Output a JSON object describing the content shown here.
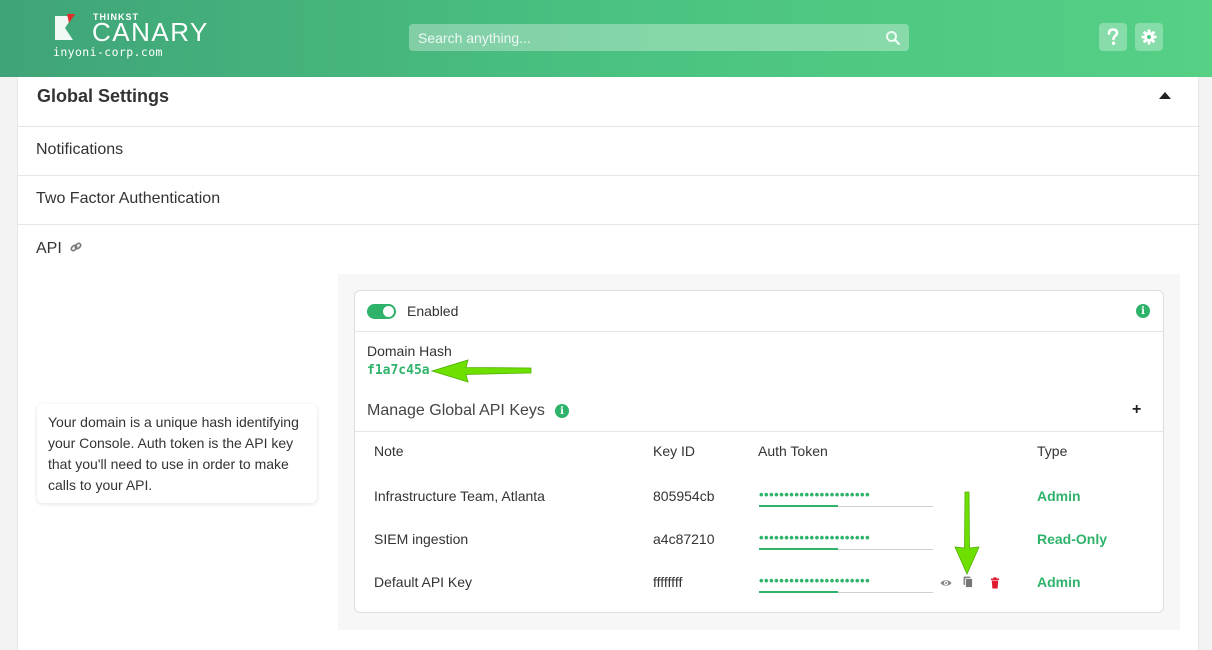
{
  "header": {
    "brand_small": "THINKST",
    "brand_big": "CANARY",
    "domain": "inyoni-corp.com",
    "search_placeholder": "Search anything...",
    "help_icon": "question-icon",
    "settings_icon": "gear-icon"
  },
  "settings": {
    "title": "Global Settings",
    "sections": [
      {
        "label": "Notifications"
      },
      {
        "label": "Two Factor Authentication"
      },
      {
        "label": "API"
      }
    ]
  },
  "api": {
    "enabled_label": "Enabled",
    "enabled": true,
    "domain_hash_label": "Domain Hash",
    "domain_hash_value": "f1a7c45a",
    "manage_title": "Manage Global API Keys",
    "add_label": "+",
    "columns": [
      "Note",
      "Key ID",
      "Auth Token",
      "Type"
    ],
    "keys": [
      {
        "note": "Infrastructure Team, Atlanta",
        "key_id": "805954cb",
        "token": "••••••••••••••••••••••",
        "type": "Admin"
      },
      {
        "note": "SIEM ingestion",
        "key_id": "a4c87210",
        "token": "••••••••••••••••••••••",
        "type": "Read-Only"
      },
      {
        "note": "Default API Key",
        "key_id": "ffffffff",
        "token": "••••••••••••••••••••••",
        "type": "Admin"
      }
    ],
    "row_actions": [
      "eye-icon",
      "copy-icon",
      "trash-icon"
    ]
  },
  "tooltip": {
    "text": "Your domain is a unique hash identifying your Console. Auth token is the API key that you'll need to use in order to make calls to your API."
  },
  "colors": {
    "accent": "#2fb36b",
    "annotation_arrow": "#6ee000",
    "delete": "#e0192f"
  }
}
